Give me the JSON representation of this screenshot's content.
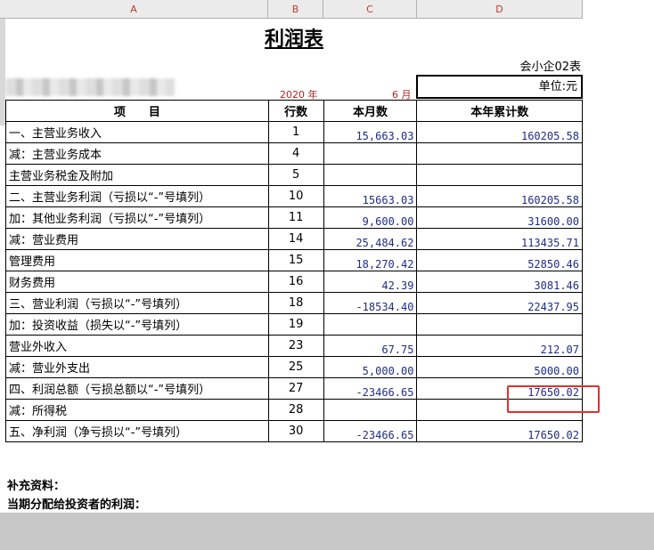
{
  "columns": [
    "A",
    "B",
    "C",
    "D"
  ],
  "title": "利润表",
  "form_code": "会小企02表",
  "date": {
    "year": "2020 年",
    "month": "6 月"
  },
  "unit": "单位:元",
  "headers": [
    "项　　目",
    "行数",
    "本月数",
    "本年累计数"
  ],
  "rows": [
    {
      "item": "一、主营业务收入",
      "line": "1",
      "month": "15,663.03",
      "ytd": "160205.58"
    },
    {
      "item": "减：主营业务成本",
      "line": "4",
      "month": "",
      "ytd": ""
    },
    {
      "item": "主营业务税金及附加",
      "line": "5",
      "month": "",
      "ytd": ""
    },
    {
      "item": "二、主营业务利润（亏损以“-”号填列）",
      "line": "10",
      "month": "15663.03",
      "ytd": "160205.58"
    },
    {
      "item": "加：其他业务利润（亏损以“-”号填列）",
      "line": "11",
      "month": "9,600.00",
      "ytd": "31600.00"
    },
    {
      "item": "减：营业费用",
      "line": "14",
      "month": "25,484.62",
      "ytd": "113435.71"
    },
    {
      "item": "管理费用",
      "line": "15",
      "month": "18,270.42",
      "ytd": "52850.46"
    },
    {
      "item": "财务费用",
      "line": "16",
      "month": "42.39",
      "ytd": "3081.46"
    },
    {
      "item": "三、营业利润（亏损以“-”号填列）",
      "line": "18",
      "month": "-18534.40",
      "ytd": "22437.95"
    },
    {
      "item": "加：投资收益（损失以“-”号填列）",
      "line": "19",
      "month": "",
      "ytd": ""
    },
    {
      "item": "营业外收入",
      "line": "23",
      "month": "67.75",
      "ytd": "212.07"
    },
    {
      "item": "减：营业外支出",
      "line": "25",
      "month": "5,000.00",
      "ytd": "5000.00"
    },
    {
      "item": "四、利润总额（亏损总额以“-”号填列）",
      "line": "27",
      "month": "-23466.65",
      "ytd": "17650.02"
    },
    {
      "item": "减：所得税",
      "line": "28",
      "month": "",
      "ytd": ""
    },
    {
      "item": "五、净利润（净亏损以“-”号填列）",
      "line": "30",
      "month": "-23466.65",
      "ytd": "17650.02"
    }
  ],
  "supplement": {
    "label": "补充资料：",
    "distributed": "当期分配给投资者的利润："
  },
  "colors": {
    "col_header_text": "#c0392b",
    "amount_text": "#1f2d8a",
    "highlight_border": "#e03030",
    "date_text": "#b22222"
  }
}
